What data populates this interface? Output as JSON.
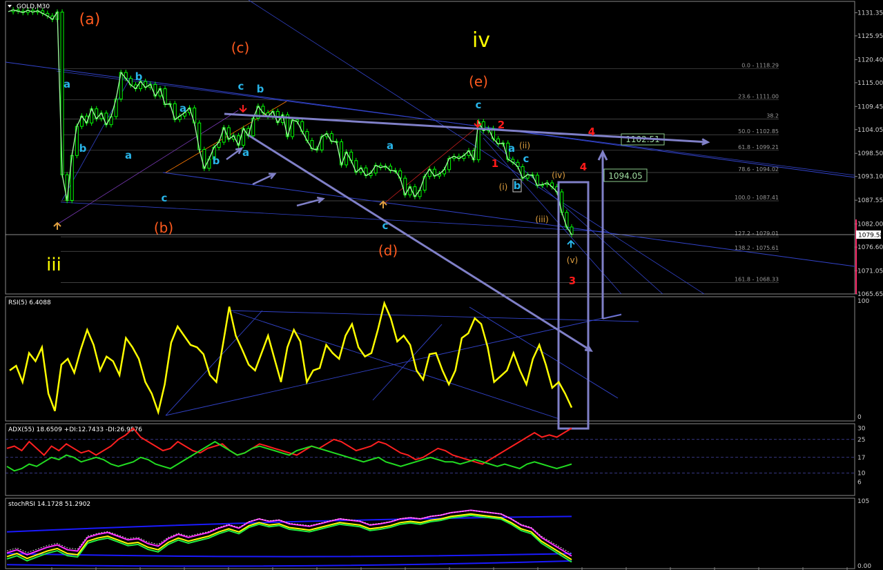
{
  "symbol_label": "GOLD,M30",
  "colors": {
    "background": "#000000",
    "bull_candle": "#00ff00",
    "price_line": "#9cf59c",
    "rsi_line": "#ffff00",
    "adx_plus": "#ff2020",
    "adx_minus": "#22dd22",
    "trend_line": "#3344cc",
    "fib_line": "#555555",
    "annot_arrow": "#8080c8",
    "wave_orange": "#ff5a1e",
    "wave_yellow": "#ffff00",
    "wave_cyan": "#28b4e8",
    "wave_red": "#ff1a1a",
    "wave_tan": "#e0a040"
  },
  "panels": {
    "main": {
      "ylim": [
        1065.65,
        1134.0
      ]
    },
    "rsi": {
      "title": "RSI(5) 6.4088",
      "ylim": [
        0,
        100
      ],
      "ticks": [
        "100",
        "0"
      ]
    },
    "adx": {
      "title": "ADX(55) 18.6509 +DI:12.7433 -DI:26.9576",
      "ylim": [
        0,
        32
      ],
      "ticks": [
        "30",
        "25",
        "17",
        "10",
        "6"
      ]
    },
    "stoch": {
      "title": "stochRSI 14.1728 51.2902",
      "ylim": [
        0,
        105
      ],
      "ticks": [
        "105",
        "0.00"
      ]
    }
  },
  "price_axis_ticks": [
    "1131.35",
    "1125.95",
    "1120.40",
    "1115.00",
    "1109.45",
    "1104.05",
    "1098.50",
    "1093.10",
    "1087.55",
    "1082.00",
    "1076.60",
    "1071.05",
    "1065.65"
  ],
  "current_price": "1079.58",
  "fib_levels": [
    {
      "label": "0.0 - 1118.29",
      "price": 1118.29
    },
    {
      "label": "23.6 - 1111.00",
      "price": 1111.0
    },
    {
      "label": "38.2",
      "price": 1106.5
    },
    {
      "label": "50.0 - 1102.85",
      "price": 1102.85
    },
    {
      "label": "61.8 - 1099.21",
      "price": 1099.21
    },
    {
      "label": "78.6 - 1094.02",
      "price": 1094.02
    },
    {
      "label": "100.0 - 1087.41",
      "price": 1087.41
    },
    {
      "label": "127.2 - 1079.01",
      "price": 1079.01
    },
    {
      "label": "138.2 - 1075.61",
      "price": 1075.61
    },
    {
      "label": "161.8 - 1068.33",
      "price": 1068.33
    }
  ],
  "target_boxes": [
    {
      "label": "1102.51",
      "price": 1102.51
    },
    {
      "label": "1094.05",
      "price": 1094.05
    }
  ],
  "wave_labels": [
    {
      "text": "(a)",
      "color": "orange"
    },
    {
      "text": "(b)",
      "color": "orange"
    },
    {
      "text": "(c)",
      "color": "orange"
    },
    {
      "text": "(d)",
      "color": "orange"
    },
    {
      "text": "(e)",
      "color": "orange"
    },
    {
      "text": "iii",
      "color": "yellow"
    },
    {
      "text": "iv",
      "color": "yellow"
    },
    {
      "text": "a",
      "color": "cyan"
    },
    {
      "text": "b",
      "color": "cyan"
    },
    {
      "text": "b",
      "color": "cyan"
    },
    {
      "text": "a",
      "color": "cyan"
    },
    {
      "text": "a",
      "color": "cyan"
    },
    {
      "text": "c",
      "color": "cyan"
    },
    {
      "text": "b",
      "color": "cyan"
    },
    {
      "text": "c",
      "color": "cyan"
    },
    {
      "text": "b",
      "color": "cyan"
    },
    {
      "text": "a",
      "color": "cyan"
    },
    {
      "text": "a",
      "color": "cyan"
    },
    {
      "text": "c",
      "color": "cyan"
    },
    {
      "text": "c",
      "color": "cyan"
    },
    {
      "text": "a",
      "color": "cyan"
    },
    {
      "text": "c",
      "color": "cyan"
    },
    {
      "text": "b",
      "color": "cyan"
    },
    {
      "text": "2",
      "color": "red"
    },
    {
      "text": "1",
      "color": "red"
    },
    {
      "text": "4",
      "color": "red"
    },
    {
      "text": "4",
      "color": "red"
    },
    {
      "text": "3",
      "color": "red"
    },
    {
      "text": "(ii)",
      "color": "tan"
    },
    {
      "text": "(i)",
      "color": "tan"
    },
    {
      "text": "(iv)",
      "color": "tan"
    },
    {
      "text": "(iii)",
      "color": "tan"
    },
    {
      "text": "(v)",
      "color": "tan"
    }
  ],
  "chart_data": {
    "type": "line",
    "title": "GOLD,M30",
    "xlabel": "",
    "ylabel": "",
    "ylim": [
      1065.65,
      1134.0
    ],
    "grid": false,
    "series": [
      {
        "name": "GOLD,M30",
        "values": [
          1131.6,
          1132.0,
          1131.7,
          1131.4,
          1131.9,
          1131.5,
          1131.8,
          1131.2,
          1130.6,
          1129.8,
          1131.5,
          1093.5,
          1087.5,
          1098.0,
          1104.8,
          1107.2,
          1105.6,
          1108.9,
          1106.6,
          1107.9,
          1105.2,
          1107.1,
          1111.2,
          1117.4,
          1116.0,
          1114.5,
          1113.6,
          1115.3,
          1113.9,
          1114.6,
          1111.9,
          1113.6,
          1109.9,
          1110.1,
          1106.4,
          1107.2,
          1108.0,
          1109.1,
          1105.6,
          1099.4,
          1095.0,
          1097.2,
          1099.9,
          1101.1,
          1104.5,
          1101.8,
          1102.6,
          1100.4,
          1104.3,
          1102.6,
          1106.7,
          1109.5,
          1108.0,
          1107.1,
          1108.3,
          1105.7,
          1107.5,
          1102.4,
          1106.3,
          1105.9,
          1103.6,
          1101.5,
          1099.6,
          1099.3,
          1102.4,
          1103.1,
          1101.3,
          1101.2,
          1095.8,
          1098.8,
          1096.8,
          1094.1,
          1095.1,
          1093.3,
          1093.9,
          1095.7,
          1095.2,
          1095.5,
          1094.5,
          1094.4,
          1092.7,
          1088.8,
          1090.7,
          1088.4,
          1089.9,
          1093.1,
          1094.8,
          1093.2,
          1093.7,
          1094.7,
          1097.3,
          1097.8,
          1097.3,
          1098.0,
          1099.1,
          1097.0,
          1105.9,
          1103.8,
          1104.3,
          1101.9,
          1100.7,
          1100.9,
          1097.1,
          1096.4,
          1095.4,
          1092.7,
          1093.5,
          1093.4,
          1091.0,
          1091.2,
          1091.6,
          1090.7,
          1089.5,
          1084.7,
          1081.3,
          1079.58
        ]
      }
    ],
    "indicators": {
      "rsi": [
        40,
        44,
        30,
        55,
        48,
        60,
        20,
        5,
        45,
        50,
        38,
        58,
        75,
        62,
        40,
        52,
        48,
        36,
        68,
        60,
        50,
        30,
        20,
        4,
        28,
        64,
        78,
        70,
        62,
        60,
        54,
        36,
        30,
        62,
        95,
        70,
        58,
        45,
        40,
        55,
        70,
        50,
        30,
        60,
        75,
        65,
        30,
        40,
        42,
        62,
        55,
        50,
        70,
        80,
        60,
        52,
        55,
        75,
        98,
        85,
        65,
        70,
        62,
        40,
        32,
        54,
        55,
        40,
        28,
        40,
        68,
        72,
        85,
        80,
        60,
        30,
        35,
        40,
        55,
        40,
        28,
        50,
        62,
        45,
        25,
        30,
        20,
        8
      ],
      "adx_plus": [
        21,
        22,
        20,
        24,
        21,
        18,
        22,
        20,
        23,
        21,
        19,
        20,
        18,
        20,
        22,
        25,
        27,
        30,
        26,
        24,
        22,
        20,
        21,
        24,
        22,
        20,
        19,
        21,
        22,
        23,
        20,
        18,
        19,
        21,
        23,
        22,
        21,
        20,
        19,
        18,
        20,
        22,
        21,
        23,
        25,
        24,
        22,
        20,
        21,
        22,
        24,
        23,
        21,
        19,
        18,
        16,
        17,
        19,
        21,
        20,
        18,
        17,
        16,
        15,
        14,
        16,
        18,
        20,
        22,
        24,
        26,
        28,
        26,
        27,
        26,
        28,
        30
      ],
      "adx_minus": [
        13,
        11,
        12,
        14,
        13,
        15,
        17,
        16,
        18,
        17,
        15,
        16,
        17,
        16,
        14,
        13,
        14,
        15,
        17,
        16,
        14,
        13,
        12,
        14,
        16,
        18,
        20,
        22,
        24,
        22,
        20,
        18,
        19,
        21,
        22,
        21,
        20,
        19,
        18,
        20,
        21,
        22,
        21,
        20,
        19,
        18,
        17,
        16,
        15,
        16,
        17,
        15,
        14,
        13,
        14,
        15,
        16,
        17,
        16,
        15,
        15,
        14,
        15,
        16,
        15,
        14,
        13,
        14,
        13,
        12,
        14,
        15,
        14,
        13,
        12,
        13,
        14
      ],
      "stoch_rsi": [
        15,
        20,
        12,
        18,
        24,
        28,
        20,
        18,
        40,
        45,
        48,
        42,
        36,
        38,
        30,
        26,
        38,
        45,
        40,
        44,
        48,
        55,
        60,
        55,
        65,
        70,
        66,
        68,
        62,
        60,
        58,
        62,
        66,
        70,
        68,
        66,
        60,
        62,
        65,
        70,
        72,
        70,
        74,
        76,
        80,
        82,
        84,
        82,
        80,
        78,
        70,
        60,
        55,
        40,
        30,
        20,
        10
      ]
    }
  }
}
